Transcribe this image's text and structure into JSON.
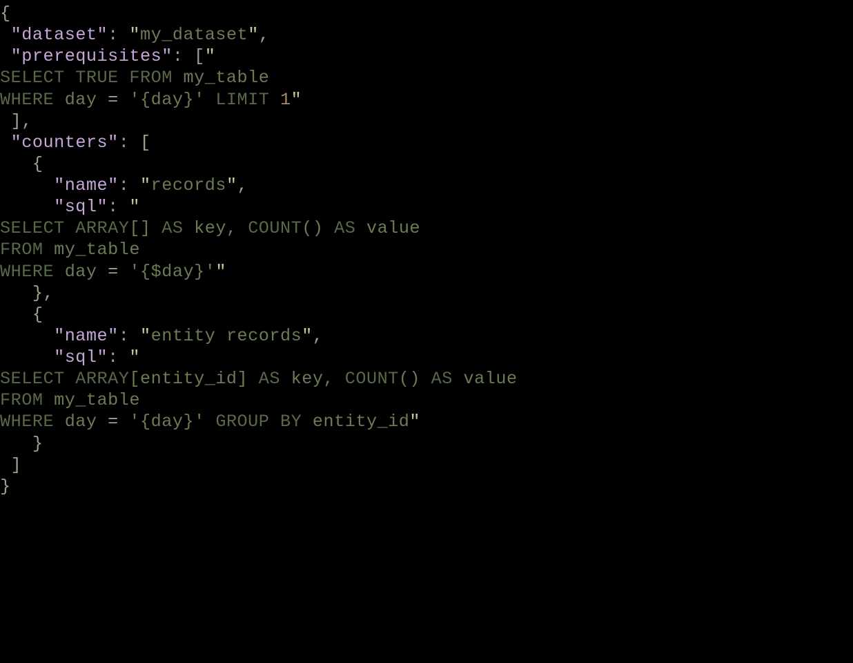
{
  "code": {
    "line01": "{",
    "line02_indent": " ",
    "line02_key": "\"dataset\"",
    "line02_colon": ": ",
    "line02_q1": "\"",
    "line02_val": "my_dataset",
    "line02_q2": "\"",
    "line02_comma": ",",
    "line03_indent": " ",
    "line03_key": "\"prerequisites\"",
    "line03_colon": ": ",
    "line03_bracket": "[",
    "line03_q": "\"",
    "line04_a": "SELECT TRUE FROM",
    "line04_b": " my_table",
    "line05_a": "WHERE",
    "line05_b": " day ",
    "line05_eq": "=",
    "line05_c": " '{day}' ",
    "line05_d": "LIMIT",
    "line05_sp": " ",
    "line05_num": "1",
    "line05_q": "\"",
    "line06": " ],",
    "line07_indent": " ",
    "line07_key": "\"counters\"",
    "line07_colon": ": ",
    "line07_bracket": "[",
    "line08": "   {",
    "line09_indent": "     ",
    "line09_key": "\"name\"",
    "line09_colon": ": ",
    "line09_q1": "\"",
    "line09_val": "records",
    "line09_q2": "\"",
    "line09_comma": ",",
    "line10_indent": "     ",
    "line10_key": "\"sql\"",
    "line10_colon": ": ",
    "line10_q": "\"",
    "line11_a": "SELECT ARRAY",
    "line11_b": "[] ",
    "line11_c": "AS",
    "line11_d": " key, ",
    "line11_e": "COUNT",
    "line11_f": "() ",
    "line11_g": "AS",
    "line11_h": " value",
    "line12_a": "FROM",
    "line12_b": " my_table",
    "line13_a": "WHERE",
    "line13_b": " day ",
    "line13_eq": "=",
    "line13_c": " '{$day}'",
    "line13_q": "\"",
    "line14": "   },",
    "line15": "   {",
    "line16_indent": "     ",
    "line16_key": "\"name\"",
    "line16_colon": ": ",
    "line16_q1": "\"",
    "line16_val": "entity records",
    "line16_q2": "\"",
    "line16_comma": ",",
    "line17_indent": "     ",
    "line17_key": "\"sql\"",
    "line17_colon": ": ",
    "line17_q": "\"",
    "line18_a": "SELECT ARRAY",
    "line18_b": "[entity_id] ",
    "line18_c": "AS",
    "line18_d": " key, ",
    "line18_e": "COUNT",
    "line18_f": "() ",
    "line18_g": "AS",
    "line18_h": " value",
    "line19_a": "FROM",
    "line19_b": " my_table",
    "line20_a": "WHERE",
    "line20_b": " day ",
    "line20_eq": "=",
    "line20_c": " '{day}' ",
    "line20_d": "GROUP BY",
    "line20_e": " entity_id",
    "line20_q": "\"",
    "line21": "   }",
    "line22": " ]",
    "line23": "}"
  },
  "json_value": {
    "dataset": "my_dataset",
    "prerequisites": [
      "\nSELECT TRUE FROM my_table\nWHERE day = '{day}' LIMIT 1"
    ],
    "counters": [
      {
        "name": "records",
        "sql": "\nSELECT ARRAY[] AS key, COUNT() AS value\nFROM my_table\nWHERE day = '{$day}'"
      },
      {
        "name": "entity records",
        "sql": "\nSELECT ARRAY[entity_id] AS key, COUNT() AS value\nFROM my_table\nWHERE day = '{day}' GROUP BY entity_id"
      }
    ]
  }
}
